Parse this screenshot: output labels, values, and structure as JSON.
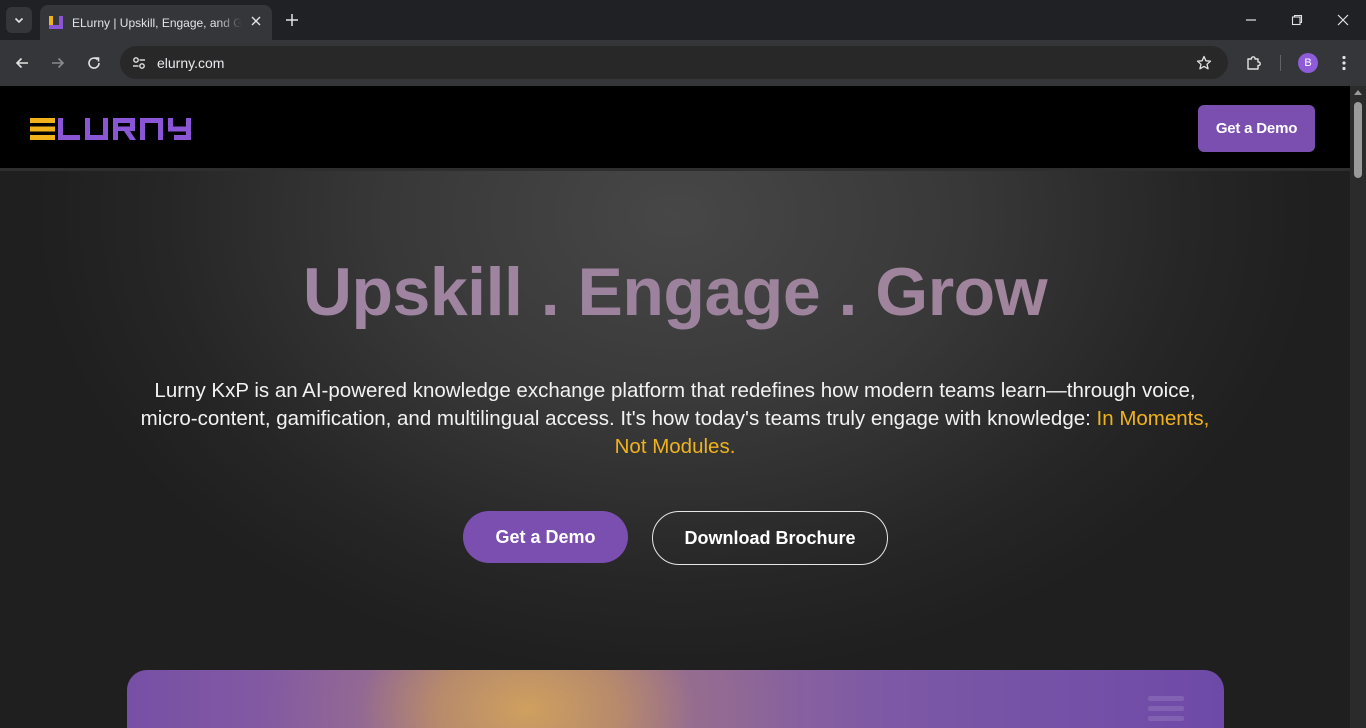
{
  "browser": {
    "tab_title": "ELurny | Upskill, Engage, and Grow",
    "url": "elurny.com",
    "profile_initial": "B",
    "icons": {
      "tab_search": "chevron-down-icon",
      "tab_close": "close-icon",
      "new_tab": "plus-icon",
      "minimize": "minimize-icon",
      "restore": "restore-icon",
      "close_window": "close-icon",
      "back": "arrow-left-icon",
      "forward": "arrow-right-icon",
      "reload": "reload-icon",
      "site_info": "tune-icon",
      "bookmark": "star-icon",
      "extensions": "puzzle-icon",
      "menu": "kebab-menu-icon"
    }
  },
  "site": {
    "logo_alt": "ELURNY",
    "header_cta": "Get a Demo",
    "hero": {
      "title": "Upskill . Engage . Grow",
      "subtitle_main": "Lurny KxP is an AI-powered knowledge exchange platform that redefines how modern teams learn—through voice, micro-content, gamification, and multilingual access. It's how today's teams truly engage with knowledge: ",
      "subtitle_accent": "In Moments, Not Modules.",
      "primary_cta": "Get a Demo",
      "secondary_cta": "Download Brochure"
    },
    "colors": {
      "brand_purple": "#7a4fb0",
      "accent_yellow": "#f0b21d",
      "logo_yellow": "#f2b21c",
      "logo_purple": "#8a56d6",
      "header_bg": "#000000"
    }
  }
}
